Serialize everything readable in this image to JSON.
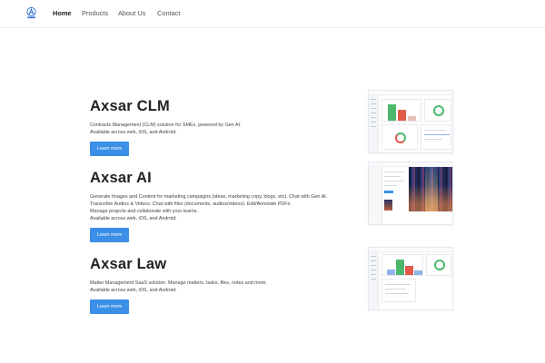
{
  "nav": {
    "logo_alt": "Axsar logo",
    "links": [
      {
        "label": "Home",
        "active": true
      },
      {
        "label": "Products",
        "active": false
      },
      {
        "label": "About Us",
        "active": false
      },
      {
        "label": "Contact",
        "active": false
      }
    ]
  },
  "products": [
    {
      "title": "Axsar CLM",
      "description": [
        "Contracts Management (CLM) solution for SMEs, powered by Gen AI.",
        "Available across web, iOS, and Android."
      ],
      "button": "Learn more"
    },
    {
      "title": "Axsar AI",
      "description": [
        "Generate Images and Content for marketing campaigns (ideas, marketing copy, blogs, etc). Chat with Gen AI.",
        "Transcribe Audios & Videos. Chat with files (documents, audios/videos). Edit/Annotate PDFs.",
        "Manage projects and collaborate with your teams.",
        "Available across web, iOS, and Android."
      ],
      "button": "Learn more"
    },
    {
      "title": "Axsar Law",
      "description": [
        "Matter Management SaaS solution. Manage matters, tasks, files, notes and more.",
        "Available across web, iOS, and Android."
      ],
      "button": "Learn more"
    }
  ],
  "colors": {
    "accent": "#3b8fe6",
    "bar_green": "#4cb86c",
    "bar_red": "#e25a4a",
    "bar_tan": "#e7c2b6",
    "bar_blue": "#8fb5e8"
  }
}
